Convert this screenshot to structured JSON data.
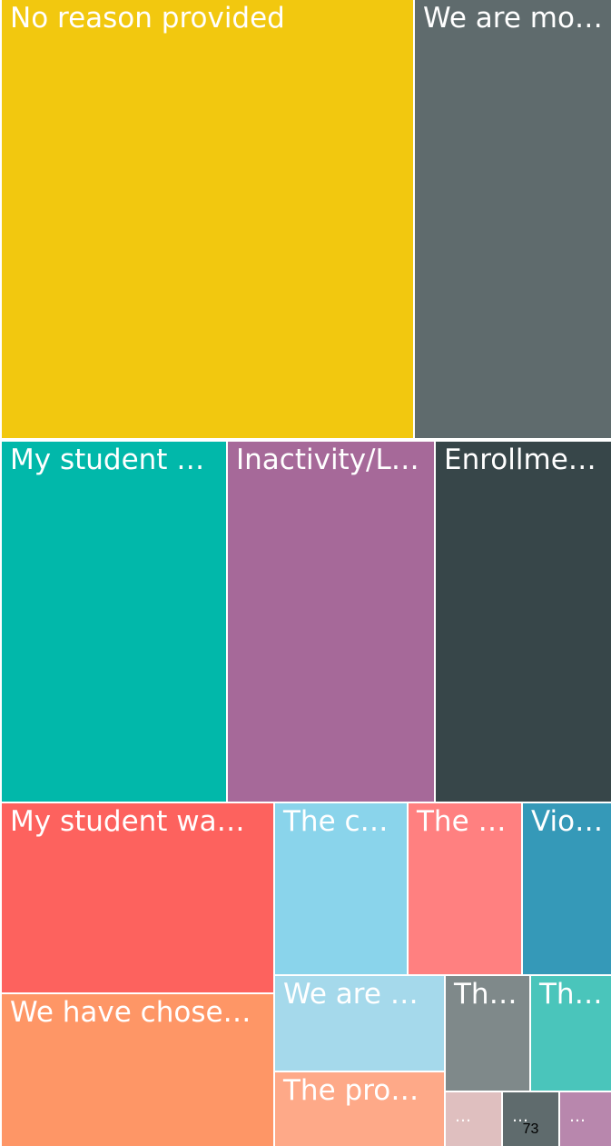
{
  "chart_data": {
    "type": "treemap",
    "items": [
      {
        "label": "No reason provided",
        "color": "#F2C80F"
      },
      {
        "label": "We are mo…",
        "color": "#5F6B6D"
      },
      {
        "label": "My student …",
        "color": "#01B8AA"
      },
      {
        "label": "Inactivity/L…",
        "color": "#A66999"
      },
      {
        "label": "Enrollme…",
        "color": "#374649"
      },
      {
        "label": "My student wa…",
        "color": "#FD625E"
      },
      {
        "label": "We have chose…",
        "color": "#FE9666"
      },
      {
        "label": "The c…",
        "color": "#8AD4EB"
      },
      {
        "label": "The …",
        "color": "#FF8080"
      },
      {
        "label": "Vio…",
        "color": "#3599B8"
      },
      {
        "label": "We are …",
        "color": "#A5D9EB"
      },
      {
        "label": "The pro…",
        "color": "#FEA988"
      },
      {
        "label": "Th…",
        "color": "#7F898A"
      },
      {
        "label": "Th…",
        "color": "#4AC5BB"
      },
      {
        "label": "…",
        "color": "#DFBFBF"
      },
      {
        "label": "…",
        "value": "73",
        "color": "#5F6B6D"
      },
      {
        "label": "…",
        "color": "#B887AD"
      }
    ]
  }
}
